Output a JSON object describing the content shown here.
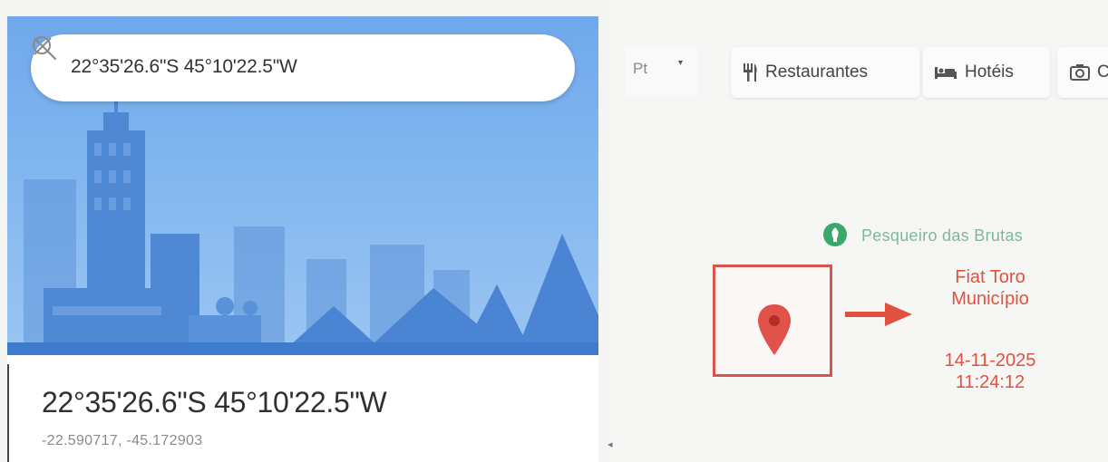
{
  "search": {
    "query": "22°35'26.6\"S 45°10'22.5\"W"
  },
  "place": {
    "title": "22°35'26.6\"S 45°10'22.5\"W",
    "decimal": "-22.590717, -45.172903"
  },
  "map": {
    "layer_label": "Pt",
    "chips": [
      {
        "label": "Restaurantes",
        "icon": "fork-knife-icon"
      },
      {
        "label": "Hotéis",
        "icon": "bed-icon"
      },
      {
        "label": "C",
        "icon": "camera-icon"
      }
    ],
    "poi": {
      "label": "Pesqueiro das Brutas",
      "icon": "park-icon"
    },
    "annotation": {
      "line1": "Fiat Toro",
      "line2": "Município",
      "date": "14-11-2025",
      "time": "11:24:12"
    },
    "colors": {
      "annotation": "#e0523f",
      "pin": "#d9534f",
      "poi": "#7fb89a",
      "hero_sky": "#7fb3ee"
    }
  }
}
